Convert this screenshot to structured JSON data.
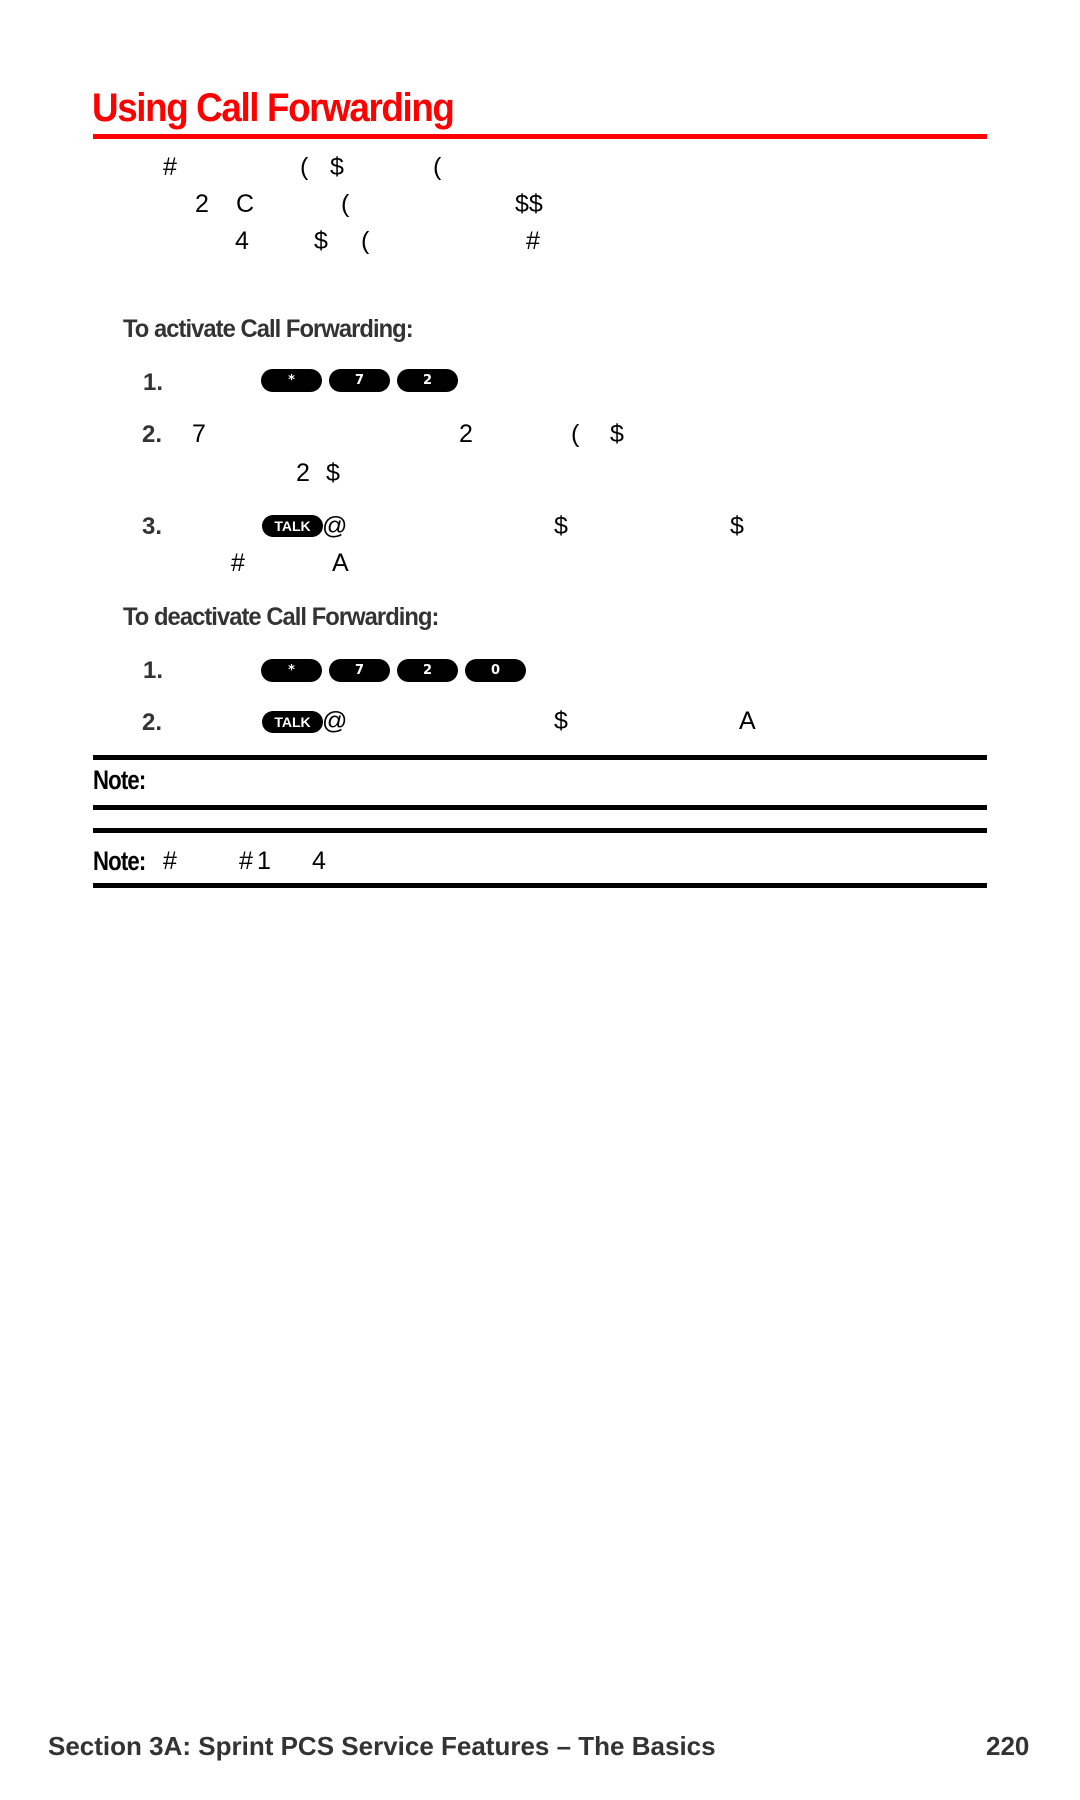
{
  "page": {
    "title": "Using Call Forwarding",
    "intro": {
      "line1": [
        {
          "text": "#",
          "x": 0
        },
        {
          "text": "(",
          "x": 1
        },
        {
          "text": "$",
          "x": 2
        },
        {
          "text": "(",
          "x": 3
        }
      ],
      "line2": [
        {
          "text": "2"
        },
        {
          "text": "C"
        },
        {
          "text": "("
        },
        {
          "text": "$$"
        }
      ],
      "line3": [
        {
          "text": "4"
        },
        {
          "text": "$"
        },
        {
          "text": "("
        },
        {
          "text": "#"
        }
      ]
    },
    "activate": {
      "heading": "To activate Call Forwarding:",
      "steps": [
        {
          "number": "1.",
          "keys": [
            "*",
            "7",
            "2"
          ]
        },
        {
          "number": "2.",
          "line1": [
            "7",
            "2",
            "(",
            "$"
          ],
          "line2": [
            "2",
            "$"
          ]
        },
        {
          "number": "3.",
          "key": "TALK",
          "line1": [
            "@",
            "$",
            "$"
          ],
          "line2": [
            "#",
            "A"
          ]
        }
      ]
    },
    "deactivate": {
      "heading": "To deactivate Call Forwarding:",
      "steps": [
        {
          "number": "1.",
          "keys": [
            "*",
            "7",
            "2",
            "0"
          ]
        },
        {
          "number": "2.",
          "key": "TALK",
          "line1": [
            "@",
            "$",
            "A"
          ]
        }
      ]
    },
    "notes": [
      {
        "label": "Note:",
        "text": []
      },
      {
        "label": "Note:",
        "text": [
          "#",
          "#",
          "1",
          "4"
        ]
      }
    ],
    "footer": {
      "section": "Section 3A: Sprint PCS Service Features – The Basics",
      "page_number": "220"
    },
    "colors": {
      "accent": "#ff0000",
      "text": "#000000",
      "heading_gray": "#333333"
    }
  }
}
